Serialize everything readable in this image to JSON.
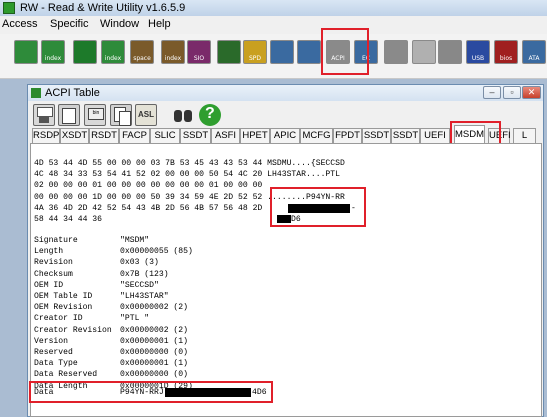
{
  "app": {
    "title": "RW - Read & Write Utility v1.6.5.9"
  },
  "menu": [
    "Access",
    "Specific",
    "Window",
    "Help"
  ],
  "toolbar": {
    "buttons": [
      {
        "name": "memory",
        "label": "",
        "color": "#2e8b3a"
      },
      {
        "name": "index",
        "label": "index",
        "color": "#2e8b3a"
      },
      {
        "name": "pci",
        "label": "",
        "color": "#1d7a2a"
      },
      {
        "name": "index2",
        "label": "index",
        "color": "#2e8b3a"
      },
      {
        "name": "space",
        "label": "space",
        "color": "#7a5a2a"
      },
      {
        "name": "index-io",
        "label": "index",
        "color": "#7a5a2a"
      },
      {
        "name": "sio",
        "label": "SIO",
        "color": "#7a2a6a"
      },
      {
        "name": "wave",
        "label": "",
        "color": "#2a6a2a"
      },
      {
        "name": "spd",
        "label": "SPD",
        "color": "#c9a020"
      },
      {
        "name": "smbus",
        "label": "",
        "color": "#3a6aa0"
      },
      {
        "name": "apic",
        "label": "",
        "color": "#3a6aa0"
      },
      {
        "name": "acpi",
        "label": "ACPI",
        "color": "#8a8a8a"
      },
      {
        "name": "ec",
        "label": "EC",
        "color": "#3a6aa0"
      },
      {
        "name": "hdd",
        "label": "",
        "color": "#8a8a8a"
      },
      {
        "name": "cd",
        "label": "",
        "color": "#b0b0b0"
      },
      {
        "name": "io",
        "label": "",
        "color": "#888"
      },
      {
        "name": "usb",
        "label": "USB",
        "color": "#2a4aa0"
      },
      {
        "name": "smbios",
        "label": "bios",
        "color": "#a02020"
      },
      {
        "name": "ata",
        "label": "ATA",
        "color": "#3a6aa0"
      },
      {
        "name": "nvme",
        "label": "",
        "color": "#888"
      }
    ]
  },
  "acpi_window": {
    "title": "ACPI Table",
    "toolbar_icons": [
      "save-icon",
      "refresh-icon",
      "binary-icon",
      "copy-icon",
      "asl-icon",
      "binoculars-icon",
      "help-icon"
    ],
    "asl_label": "ASL",
    "help_label": "?",
    "tabs": [
      "RSDP",
      "XSDT",
      "RSDT",
      "FACP",
      "SLIC",
      "SSDT",
      "ASFI",
      "HPET",
      "APIC",
      "MCFG",
      "FPDT",
      "SSDT",
      "SSDT",
      "UEFI",
      "MSDM",
      "UEFI",
      "L"
    ],
    "active_tab": "MSDM",
    "hex_lines": [
      "4D 53 44 4D 55 00 00 00 03 7B 53 45 43 43 53 44 MSDMU....{SECCSD",
      "4C 48 34 33 53 54 41 52 02 00 00 00 50 54 4C 20 LH43STAR....PTL",
      "02 00 00 00 01 00 00 00 00 00 00 00 01 00 00 00",
      "00 00 00 00 1D 00 00 00 50 39 34 59 4E 2D 52 52 ........P94YN-RR",
      "4A 36 4D 2D 42 52 54 43 4B 2D 56 4B 57 56 48 2D",
      "58 44 34 44 36"
    ],
    "hex_ascii_line5_end": "-",
    "hex_ascii_line6": "D6",
    "fields": [
      {
        "name": "Signature",
        "value": "\"MSDM\""
      },
      {
        "name": "Length",
        "value": "0x00000055 (85)"
      },
      {
        "name": "Revision",
        "value": "0x03 (3)"
      },
      {
        "name": "Checksum",
        "value": "0x7B (123)"
      },
      {
        "name": "OEM ID",
        "value": "\"SECCSD\""
      },
      {
        "name": "OEM Table ID",
        "value": "\"LH43STAR\""
      },
      {
        "name": "OEM Revision",
        "value": "0x00000002 (2)"
      },
      {
        "name": "Creator ID",
        "value": "\"PTL \""
      },
      {
        "name": "Creator Revision",
        "value": "0x00000002 (2)"
      },
      {
        "name": "Version",
        "value": "0x00000001 (1)"
      },
      {
        "name": "Reserved",
        "value": "0x00000000 (0)"
      },
      {
        "name": "Data Type",
        "value": "0x00000001 (1)"
      },
      {
        "name": "Data Reserved",
        "value": "0x00000000 (0)"
      },
      {
        "name": "Data Length",
        "value": "0x0000001D (29)"
      }
    ],
    "data_field": {
      "name": "Data",
      "value_prefix": "P94YN-RRJ",
      "value_suffix": "4D6"
    }
  },
  "colors": {
    "highlight": "#e0202a",
    "title_gradient": "#bfd2e8"
  }
}
